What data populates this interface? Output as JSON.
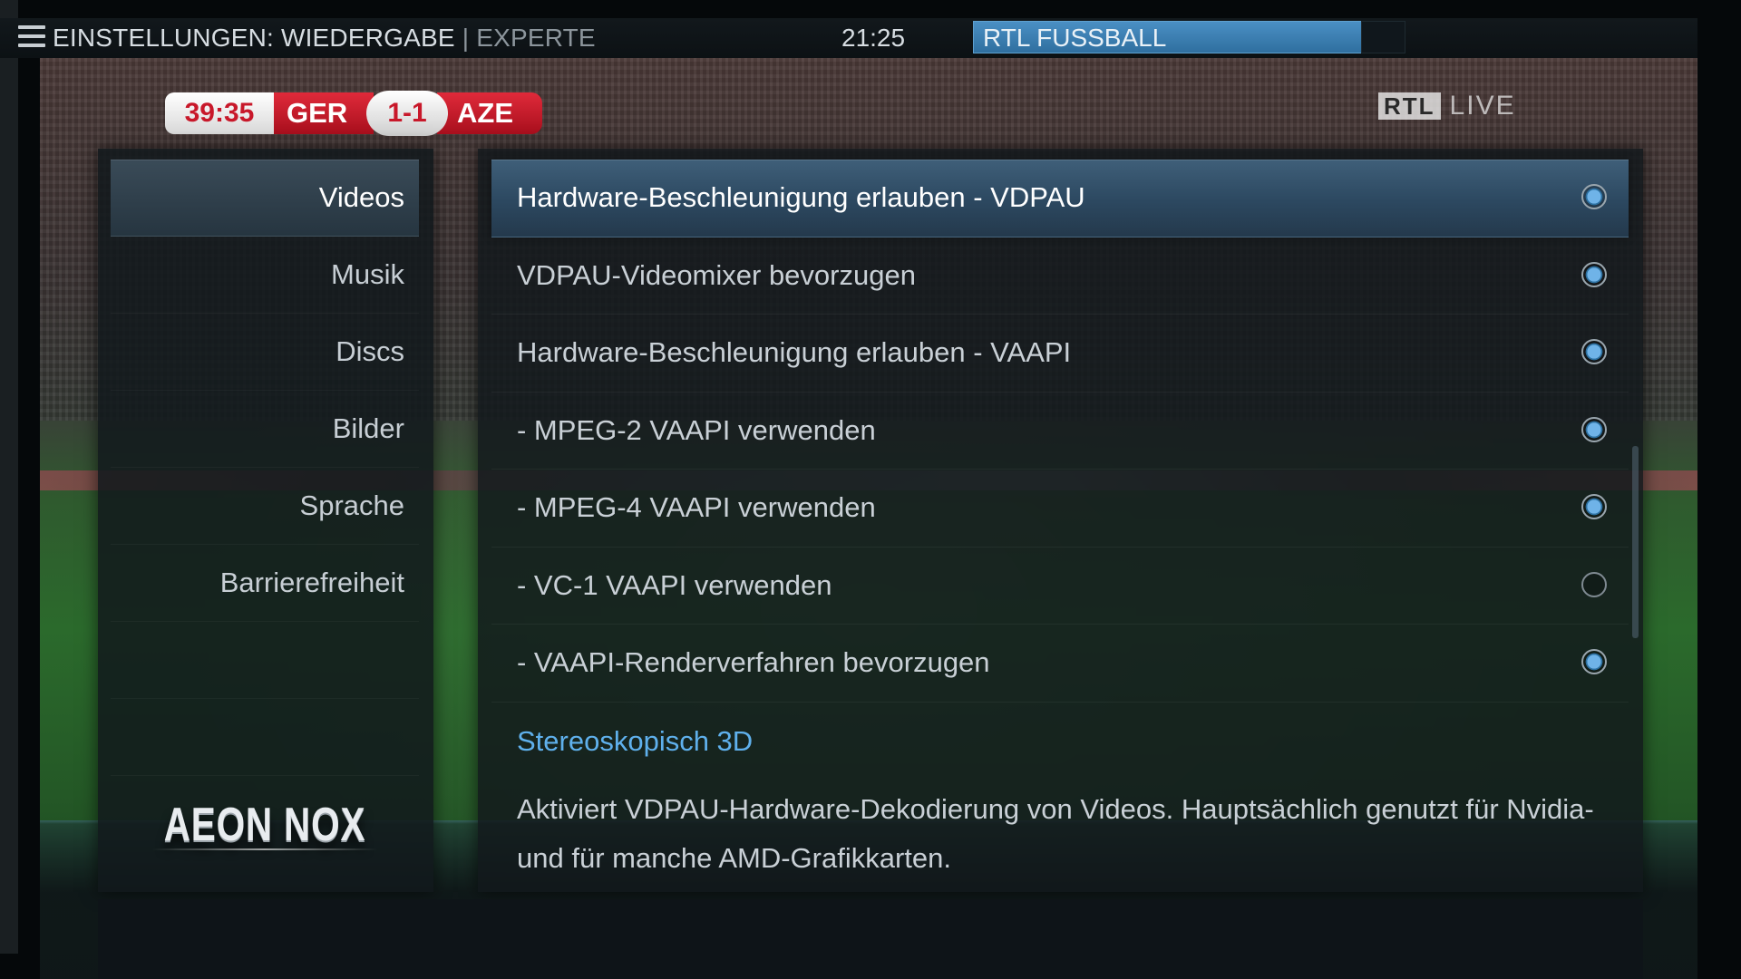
{
  "topbar": {
    "title": "EINSTELLUNGEN: WIEDERGABE",
    "separator": " | ",
    "level": "EXPERTE",
    "clock": "21:25",
    "now_playing": "RTL FUSSBALL"
  },
  "overlay": {
    "match_time": "39:35",
    "home_team": "GER",
    "score": "1-1",
    "away_team": "AZE",
    "channel_logo": "RTL",
    "channel_live": "LIVE"
  },
  "categories": [
    {
      "label": "Videos",
      "active": true
    },
    {
      "label": "Musik"
    },
    {
      "label": "Discs"
    },
    {
      "label": "Bilder"
    },
    {
      "label": "Sprache"
    },
    {
      "label": "Barrierefreiheit"
    }
  ],
  "brand": {
    "logo_text": "AEON NOX"
  },
  "options": [
    {
      "label": "Hardware-Beschleunigung erlauben - VDPAU",
      "enabled": true,
      "focused": true
    },
    {
      "label": "VDPAU-Videomixer bevorzugen",
      "enabled": true
    },
    {
      "label": "Hardware-Beschleunigung erlauben - VAAPI",
      "enabled": true
    },
    {
      "label": "- MPEG-2 VAAPI verwenden",
      "enabled": true
    },
    {
      "label": "- MPEG-4 VAAPI verwenden",
      "enabled": true
    },
    {
      "label": "- VC-1 VAAPI verwenden",
      "enabled": false
    },
    {
      "label": "- VAAPI-Renderverfahren bevorzugen",
      "enabled": true
    }
  ],
  "section_heading": "Stereoskopisch 3D",
  "description": "Aktiviert VDPAU-Hardware-Dekodierung von Videos. Hauptsächlich genutzt für Nvidia- und für manche AMD-Grafikkarten.",
  "colors": {
    "accent": "#5fb0ec",
    "now_playing_bar": "#3f84bb",
    "focus": "#345370"
  }
}
